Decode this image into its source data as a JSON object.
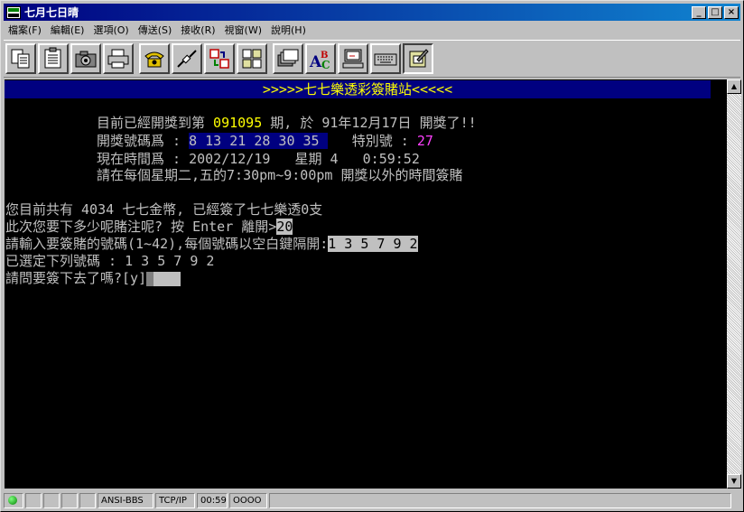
{
  "window": {
    "title": "七月七日晴"
  },
  "title_buttons": {
    "minimize": "_",
    "maximize": "□",
    "close": "×"
  },
  "menu": [
    "檔案(F)",
    "編輯(E)",
    "選項(O)",
    "傳送(S)",
    "接收(R)",
    "視窗(W)",
    "說明(H)"
  ],
  "toolbar": [
    "copy-icon",
    "clipboard-icon",
    "camera-icon",
    "printer-icon",
    "phone-icon",
    "disconnect-icon",
    "transfer-icon",
    "layout-icon",
    "folders-icon",
    "abc-icon",
    "computer-icon",
    "keyboard-icon",
    "edit-document-icon"
  ],
  "terminal": {
    "banner": ">>>>>七七樂透彩簽賭站<<<<<",
    "l1_pre": "目前已經開獎到第 ",
    "l1_period": "091095",
    "l1_post": " 期, 於 91年12月17日 開獎了!!",
    "l2_label": "開獎號碼爲 : ",
    "l2_numbers": "8 13 21 28 30 35 ",
    "l2_special_label": "   特別號 : ",
    "l2_special": "27",
    "l3": "現在時間爲 : 2002/12/19   星期 4   0:59:52",
    "l4": "請在每個星期二,五的7:30pm~9:00pm 開獎以外的時間簽賭",
    "l5": "您目前共有 4034 七七金幣, 已經簽了七七樂透0支",
    "l6_pre": "此次您要下多少呢賭注呢? 按 Enter 離開>",
    "l6_input": "20",
    "l7_pre": "請輸入要簽賭的號碼(1~42),每個號碼以空白鍵隔開:",
    "l7_input": "1 3 5 7 9 2",
    "l8": "已選定下列號碼 : 1 3 5 7 9 2",
    "l9": "請問要簽下去了嗎?[y]"
  },
  "statusbar": {
    "emulation": "ANSI-BBS",
    "protocol": "TCP/IP",
    "time": "00:59",
    "lights": "OOOO"
  },
  "colors": {
    "terminal_bg": "#000000",
    "terminal_fg": "#c0c0c0",
    "banner_bg": "#000080",
    "highlight": "#ffff00",
    "special": "#ff40ff"
  }
}
